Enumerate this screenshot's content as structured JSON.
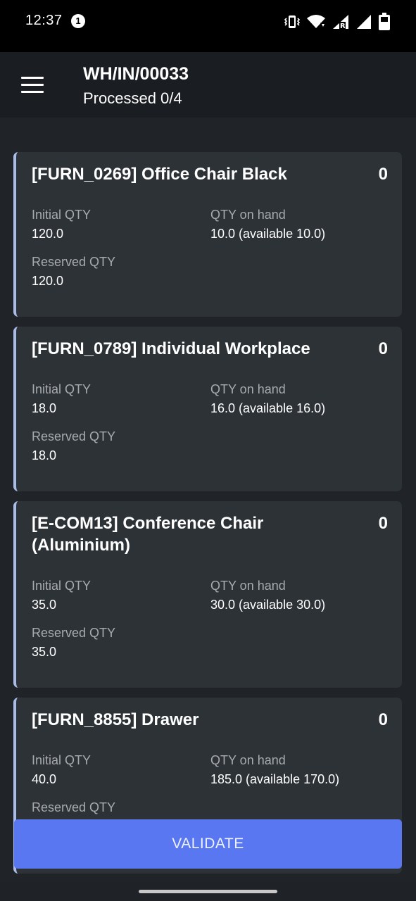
{
  "status_bar": {
    "time": "12:37",
    "notification_count": "1",
    "icons": [
      "vibrate-icon",
      "wifi-icon",
      "signal-roaming-icon",
      "signal-icon",
      "battery-icon"
    ]
  },
  "header": {
    "title": "WH/IN/00033",
    "subtitle": "Processed 0/4"
  },
  "labels": {
    "initial_qty": "Initial QTY",
    "qty_on_hand": "QTY on hand",
    "reserved_qty": "Reserved QTY"
  },
  "cards": [
    {
      "title": "[FURN_0269] Office Chair Black",
      "count": "0",
      "initial_qty": "120.0",
      "qty_on_hand": "10.0 (available 10.0)",
      "reserved_qty": "120.0"
    },
    {
      "title": "[FURN_0789] Individual Workplace",
      "count": "0",
      "initial_qty": "18.0",
      "qty_on_hand": "16.0 (available 16.0)",
      "reserved_qty": "18.0"
    },
    {
      "title": "[E-COM13] Conference Chair (Aluminium)",
      "count": "0",
      "initial_qty": "35.0",
      "qty_on_hand": "30.0 (available 30.0)",
      "reserved_qty": "35.0"
    },
    {
      "title": "[FURN_8855] Drawer",
      "count": "0",
      "initial_qty": "40.0",
      "qty_on_hand": "185.0 (available 170.0)",
      "reserved_qty": ""
    }
  ],
  "actions": {
    "validate_label": "VALIDATE"
  },
  "colors": {
    "accent": "#5877f0",
    "card_stripe": "#a9bde8",
    "card_background": "#2d3237"
  }
}
